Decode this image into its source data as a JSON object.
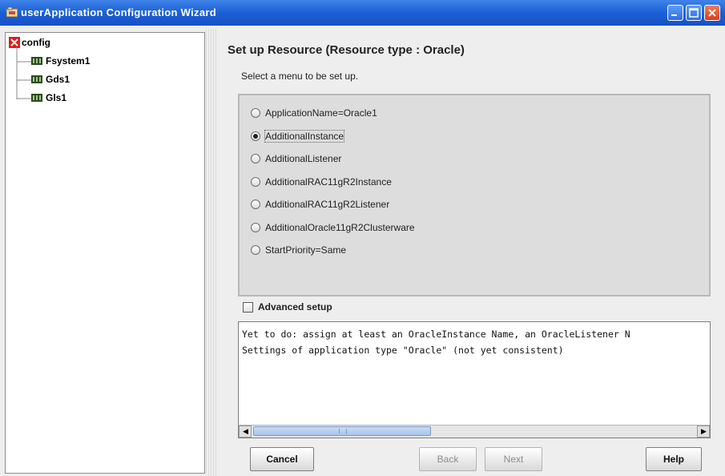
{
  "window": {
    "title": "userApplication Configuration Wizard",
    "title_color": "#1c5fd3"
  },
  "tree": {
    "root": "config",
    "children": [
      "Fsystem1",
      "Gds1",
      "Gls1"
    ]
  },
  "main": {
    "heading": "Set up Resource (Resource type : Oracle)",
    "subtitle": "Select a menu to be set up.",
    "options": [
      {
        "label": "ApplicationName=Oracle1",
        "selected": false
      },
      {
        "label": "AdditionalInstance",
        "selected": true
      },
      {
        "label": "AdditionalListener",
        "selected": false
      },
      {
        "label": "AdditionalRAC11gR2Instance",
        "selected": false
      },
      {
        "label": "AdditionalRAC11gR2Listener",
        "selected": false
      },
      {
        "label": "AdditionalOracle11gR2Clusterware",
        "selected": false
      },
      {
        "label": "StartPriority=Same",
        "selected": false
      }
    ],
    "advanced_setup_label": "Advanced setup",
    "advanced_setup_checked": false,
    "messages": [
      "Yet to do: assign at least an OracleInstance Name, an OracleListener N",
      "Settings of application type \"Oracle\" (not yet consistent)"
    ]
  },
  "buttons": {
    "cancel": "Cancel",
    "back": "Back",
    "next": "Next",
    "help": "Help"
  }
}
